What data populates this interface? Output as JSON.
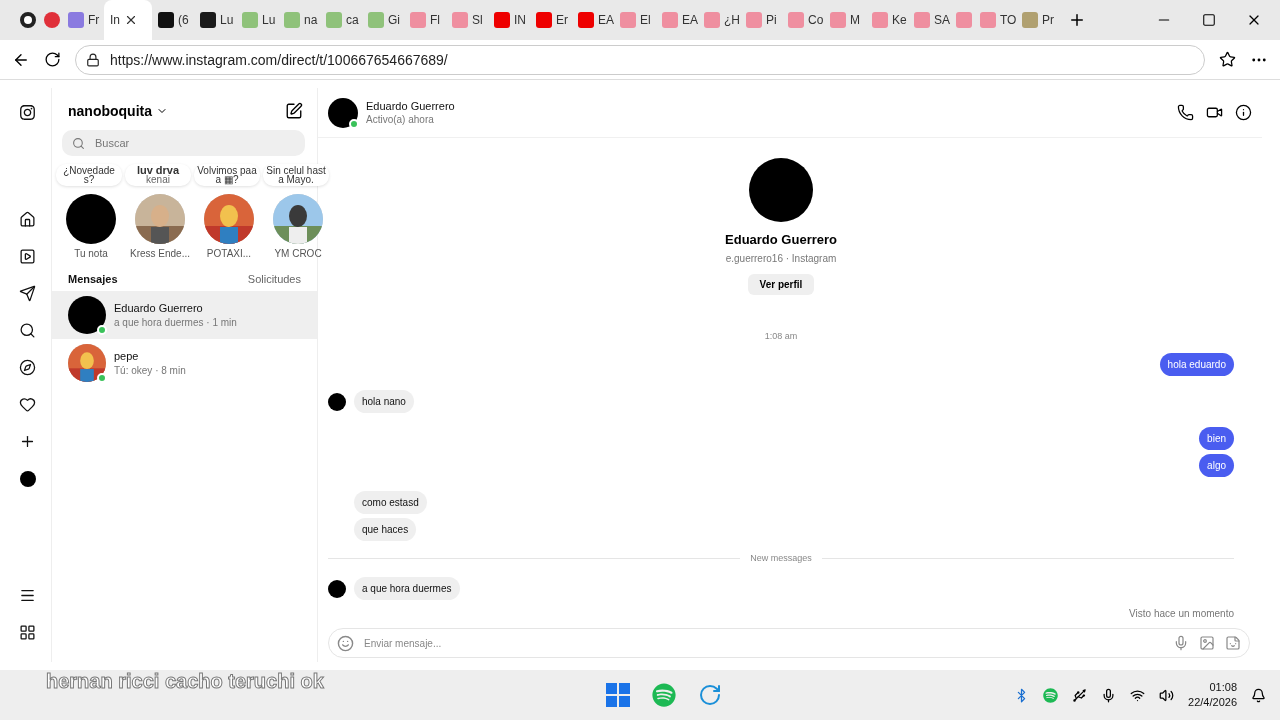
{
  "browser": {
    "tabs": [
      {
        "kind": "record",
        "selected": false
      },
      {
        "kind": "dot",
        "selected": false
      },
      {
        "label": "Fr",
        "kind": "purple",
        "selected": false
      },
      {
        "label": "In",
        "kind": "plain",
        "selected": true
      },
      {
        "label": "(6",
        "kind": "x",
        "selected": false
      },
      {
        "label": "Lu",
        "kind": "kblack",
        "selected": false
      },
      {
        "label": "Lu",
        "kind": "kgreen",
        "selected": false
      },
      {
        "label": "na",
        "kind": "kgreen",
        "selected": false
      },
      {
        "label": "ca",
        "kind": "kgreen",
        "selected": false
      },
      {
        "label": "Gi",
        "kind": "kgreen",
        "selected": false
      },
      {
        "label": "Fl",
        "kind": "pink",
        "selected": false
      },
      {
        "label": "Sl",
        "kind": "pink",
        "selected": false
      },
      {
        "label": "IN",
        "kind": "youtube",
        "selected": false
      },
      {
        "label": "Er",
        "kind": "youtube",
        "selected": false
      },
      {
        "label": "EA",
        "kind": "youtube",
        "selected": false
      },
      {
        "label": "El",
        "kind": "pink",
        "selected": false
      },
      {
        "label": "EA",
        "kind": "pink",
        "selected": false
      },
      {
        "label": "¿H",
        "kind": "pink",
        "selected": false
      },
      {
        "label": "Pi",
        "kind": "pink",
        "selected": false
      },
      {
        "label": "Co",
        "kind": "pink",
        "selected": false
      },
      {
        "label": "M",
        "kind": "pink",
        "selected": false
      },
      {
        "label": "Ke",
        "kind": "pink",
        "selected": false
      },
      {
        "label": "SA",
        "kind": "pink",
        "selected": false
      },
      {
        "kind": "pink",
        "selected": false
      },
      {
        "label": "TO",
        "kind": "pink",
        "selected": false
      },
      {
        "label": "Pr",
        "kind": "app",
        "selected": false
      }
    ],
    "url": "https://www.instagram.com/direct/t/100667654667689/"
  },
  "inbox": {
    "username": "nanoboquita",
    "search": {
      "placeholder": "Buscar"
    },
    "notes": [
      {
        "kind": "text",
        "note": "¿Novedades?",
        "name": "Tu nota"
      },
      {
        "kind": "music",
        "note": "luv drva",
        "artist": "kenai",
        "name": "Kress Ende..."
      },
      {
        "kind": "text",
        "note": "Volvimos paaa ▦?",
        "name": "POTAXI..."
      },
      {
        "kind": "text",
        "note": "Sin celul hasta Mayo.",
        "name": "YM CROC"
      }
    ],
    "sections": [
      {
        "label": "Mensajes",
        "selected": true
      },
      {
        "label": "Solicitudes",
        "selected": false
      }
    ],
    "conversations": [
      {
        "kind": "plain",
        "name": "Eduardo Guerrero",
        "preview": "a que hora duermes · 1 min",
        "selected": true,
        "online": true
      },
      {
        "name": "pepe",
        "preview": "Tú: okey · 8 min",
        "selected": false,
        "online": true
      }
    ]
  },
  "chat": {
    "name": "Eduardo Guerrero",
    "status": "Activo(a) ahora",
    "online": true,
    "profile": {
      "name": "Eduardo Guerrero",
      "handle": "e.guerrero16 · Instagram",
      "button": "Ver perfil"
    },
    "items": [
      {
        "kind": "time",
        "text": "1:08 am"
      },
      {
        "kind": "sent",
        "text": "hola eduardo"
      },
      {
        "kind": "received",
        "text": "hola nano",
        "avatar": true
      },
      {
        "kind": "sent",
        "text": "bien"
      },
      {
        "kind": "sent",
        "text": "algo"
      },
      {
        "kind": "received",
        "text": "como estasd",
        "avatar": false
      },
      {
        "kind": "received",
        "text": "que haces",
        "avatar": false
      },
      {
        "kind": "divider",
        "text": "New messages"
      },
      {
        "kind": "received",
        "text": "a que hora duermes",
        "avatar": true
      }
    ],
    "seen": "Visto hace un momento",
    "composer": {
      "placeholder": "Enviar mensaje..."
    }
  },
  "caption": "hernan ricci cacho teruchi ok",
  "taskbar": {
    "time": "01:08",
    "date": "22/4/2026"
  }
}
